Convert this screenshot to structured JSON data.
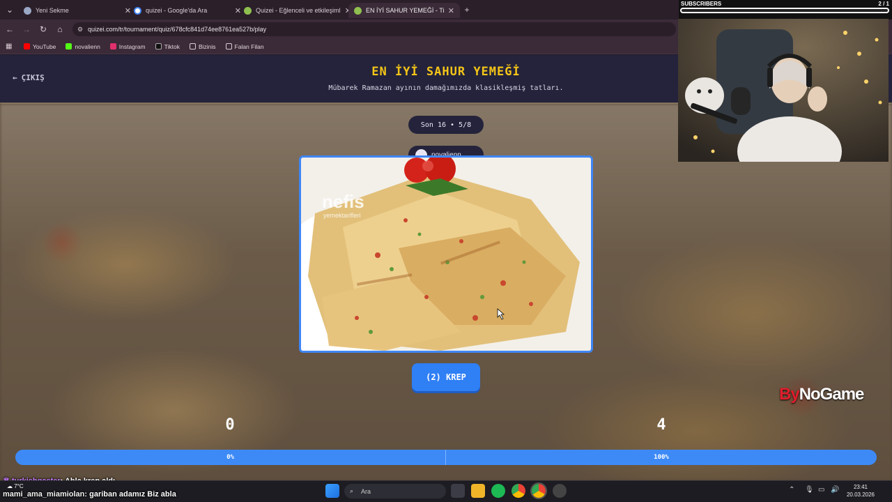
{
  "browser": {
    "tabs": [
      {
        "title": "Yeni Sekme",
        "icon": "globe-icon"
      },
      {
        "title": "quizei - Google'da Ara",
        "icon": "google-icon"
      },
      {
        "title": "Quizei - Eğlenceli ve etkileşimli",
        "icon": "quizei-icon"
      },
      {
        "title": "EN İYİ SAHUR YEMEĞİ - Tier Lis",
        "icon": "quizei-icon"
      }
    ],
    "url": "quizei.com/tr/tournament/quiz/678cfc841d74ee8761ea527b/play",
    "bookmarks": [
      {
        "label": "YouTube",
        "color": "#ff0000"
      },
      {
        "label": "novalienn",
        "color": "#53fc18"
      },
      {
        "label": "Instagram",
        "color": "#e1306c"
      },
      {
        "label": "Tiktok",
        "color": "#111111"
      },
      {
        "label": "Bizinis",
        "color": "folder"
      },
      {
        "label": "Falan Filan",
        "color": "folder"
      }
    ]
  },
  "quiz": {
    "exit_label": "ÇIKIŞ",
    "title": "EN İYİ SAHUR YEMEĞİ",
    "subtitle": "Mübarek Ramazan ayının damağımızda klasikleşmiş tatları.",
    "round": "Son 16 • 5/8",
    "author": "novalienn",
    "image_watermark": "nefis",
    "image_watermark_sub": "yemektarifleri",
    "choice_label": "(2) KREP",
    "score_left": "0",
    "score_right": "4",
    "progress_left": "0%",
    "progress_right": "100%",
    "progress_left_fraction": 0.0,
    "accent": "#2f7ff5",
    "title_color": "#f5c518"
  },
  "overlay": {
    "subs_label": "SUBSCRIBERS",
    "subs_count": "2 / 1",
    "sponsor_prefix": "By",
    "sponsor_name": "NoGame",
    "chat": [
      {
        "user": "turkishgaster",
        "message": ": Abla krep aldı"
      },
      {
        "user": "mami_ama_miamiolan",
        "message": ": gariban adamız Biz abla"
      }
    ]
  },
  "taskbar": {
    "search_placeholder": "Ara",
    "weather": "7°C",
    "time": "23:41",
    "date": "20.03.2026"
  }
}
